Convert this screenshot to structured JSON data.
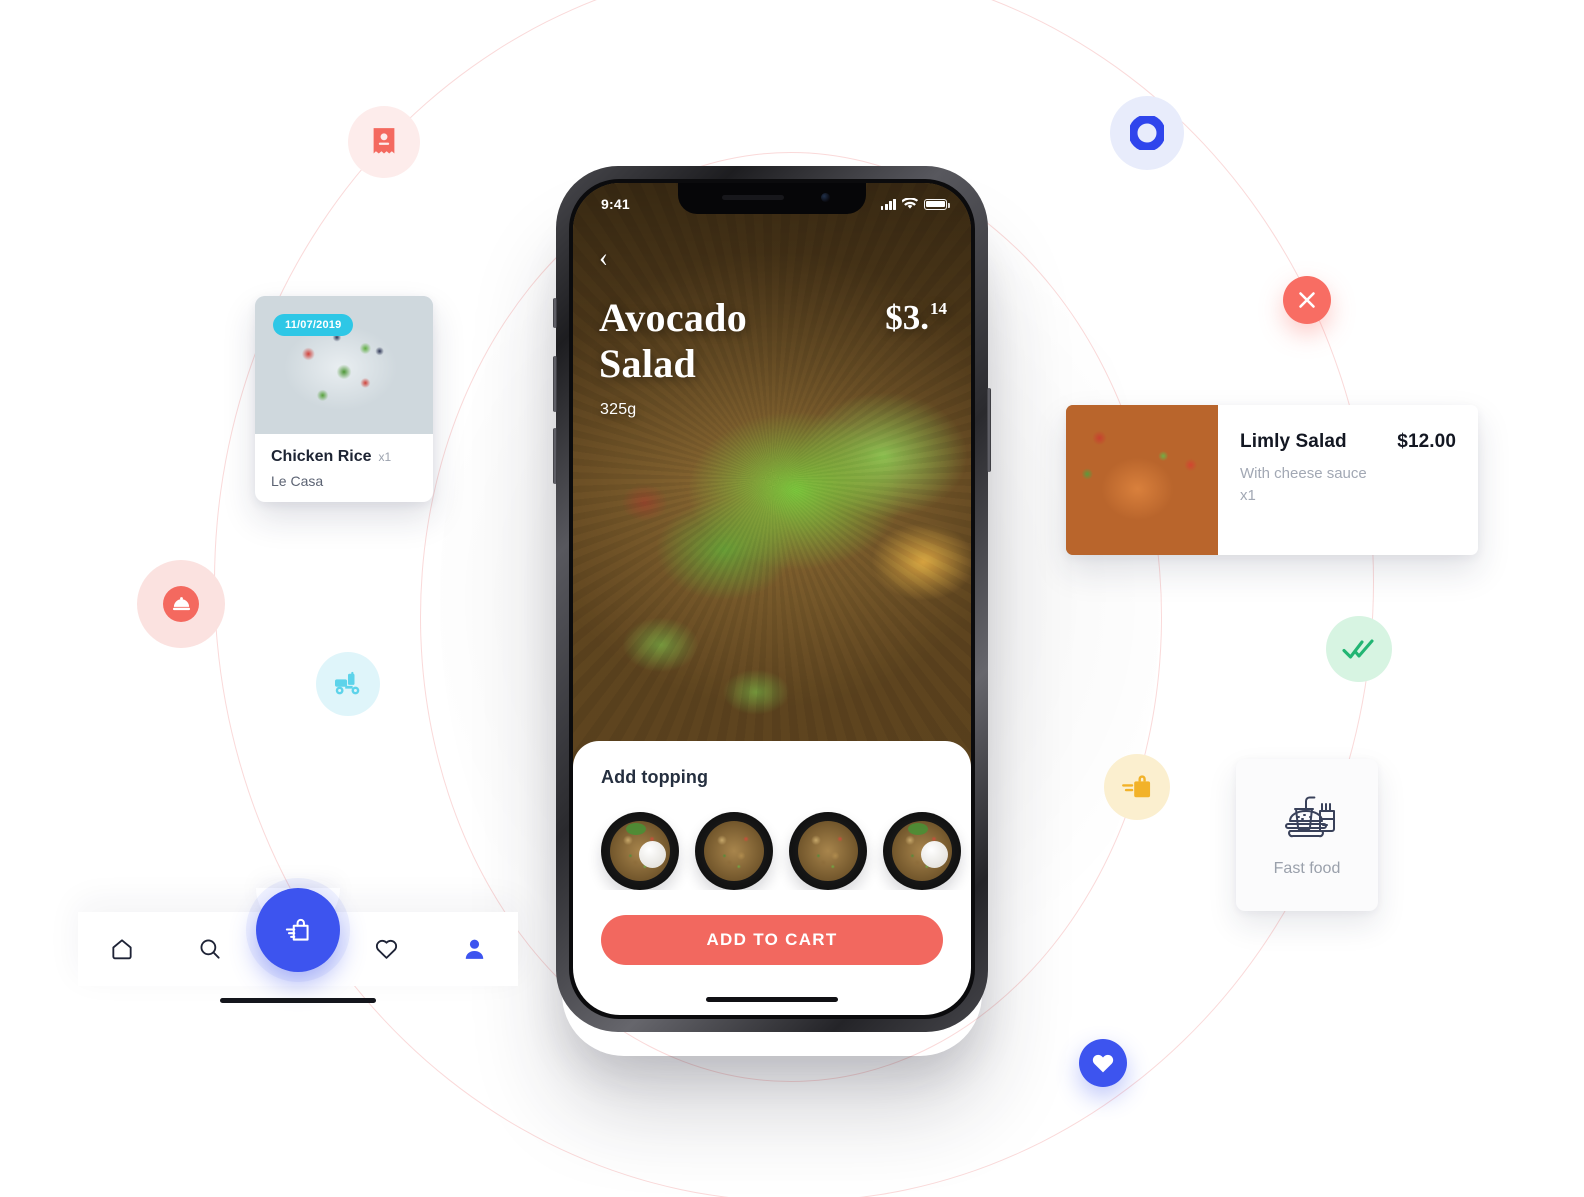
{
  "colors": {
    "coral": "#f2685f",
    "blue": "#3d54ef",
    "cyan_badge": "#2ec7e6",
    "green_check": "#22b573",
    "yellow_bag": "#f2b229",
    "navy_text": "#252f3f"
  },
  "phone": {
    "status_bar": {
      "time": "9:41",
      "signal_icon": "cellular-bars-icon",
      "wifi_icon": "wifi-icon",
      "battery_icon": "battery-full-icon"
    },
    "back_icon": "chevron-left-icon",
    "dish": {
      "title": "Avocado Salad",
      "weight": "325g",
      "price_main": "$3.",
      "price_cents": "14"
    },
    "sheet": {
      "heading": "Add topping",
      "toppings": [
        {
          "name": "topping-rice-bowl-1",
          "has_rice": true
        },
        {
          "name": "topping-fried-rice-2",
          "has_rice": false
        },
        {
          "name": "topping-shrimp-noodles-3",
          "has_rice": false
        },
        {
          "name": "topping-rice-bowl-4",
          "has_rice": true
        }
      ],
      "cart_button": "ADD TO CART"
    }
  },
  "order_card": {
    "date_badge": "11/07/2019",
    "title": "Chicken Rice",
    "quantity": "x1",
    "restaurant": "Le Casa"
  },
  "product_card": {
    "title": "Limly Salad",
    "price": "$12.00",
    "description": "With cheese sauce",
    "quantity": "x1"
  },
  "fastfood_card": {
    "icon": "fast-food-icon",
    "label": "Fast food"
  },
  "navbar": {
    "items": [
      {
        "name": "nav-home",
        "icon": "home-icon",
        "active": false
      },
      {
        "name": "nav-search",
        "icon": "search-icon",
        "active": false
      },
      {
        "name": "nav-favorites",
        "icon": "heart-outline-icon",
        "active": false
      },
      {
        "name": "nav-profile",
        "icon": "person-icon",
        "active": true
      }
    ],
    "fab": {
      "name": "cart-fab",
      "icon": "shopping-bag-icon"
    }
  },
  "badges": [
    {
      "name": "receipt-badge",
      "icon": "receipt-icon",
      "color": "#f4695f"
    },
    {
      "name": "order-dot-badge",
      "icon": "ring-dot-icon",
      "color": "#3d54ef"
    },
    {
      "name": "cancel-badge",
      "icon": "close-icon",
      "color": "#ffffff"
    },
    {
      "name": "served-dish-badge",
      "icon": "cloche-icon",
      "color": "#ffffff"
    },
    {
      "name": "delivery-scooter-badge",
      "icon": "scooter-icon",
      "color": "#5dd3ea"
    },
    {
      "name": "delivered-badge",
      "icon": "double-check-icon",
      "color": "#22b573"
    },
    {
      "name": "fast-delivery-bag-badge",
      "icon": "shopping-bag-motion-icon",
      "color": "#f2b229"
    },
    {
      "name": "favorite-badge",
      "icon": "heart-filled-icon",
      "color": "#ffffff"
    }
  ]
}
